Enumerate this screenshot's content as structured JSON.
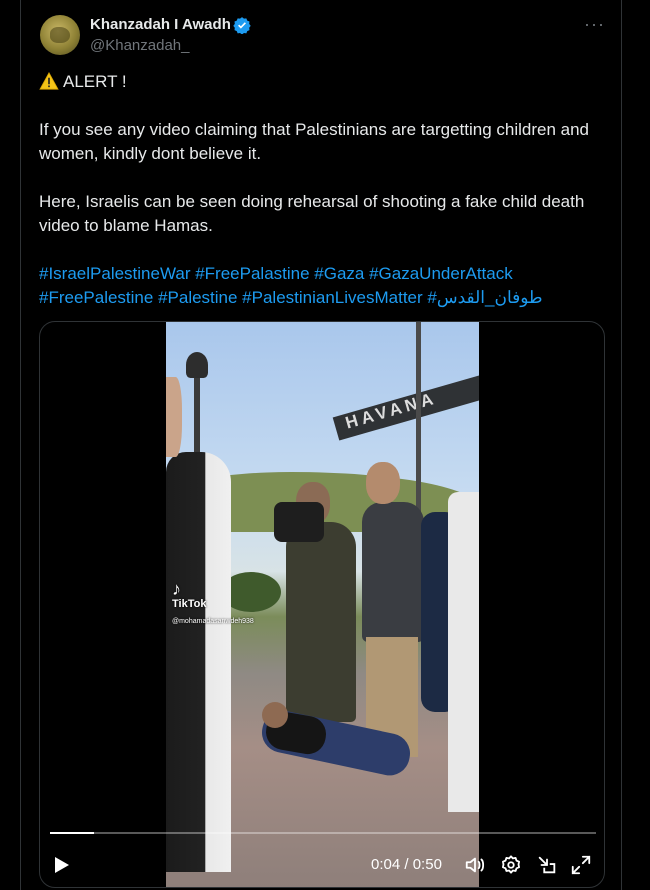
{
  "author": {
    "name": "Khanzadah I Awadh",
    "handle": "@Khanzadah_",
    "verified_icon": "verified-badge-icon"
  },
  "post": {
    "alert_line": "ALERT !",
    "paragraph1": "If you see any video claiming that Palestinians are targetting children and women, kindly dont believe it.",
    "paragraph2": "Here, Israelis can be seen doing rehearsal of shooting a fake child death video to blame Hamas.",
    "hashtags_line1": "#IsraelPalestineWar #FreePalastine #Gaza #GazaUnderAttack",
    "hashtags_line2": "#FreePalestine #Palestine #PalestinianLivesMatter #طوفان_القدس"
  },
  "video": {
    "watermark": "TikTok",
    "watermark_user": "@mohamadasanwdeh938",
    "crane_text": "HAVANA",
    "current_time": "0:04",
    "duration": "0:50",
    "progress_fraction": 0.08,
    "time_separator": " / "
  },
  "colors": {
    "link": "#1d9bf0",
    "text": "#e7e9ea",
    "muted": "#71767b",
    "border": "#2f3336"
  }
}
